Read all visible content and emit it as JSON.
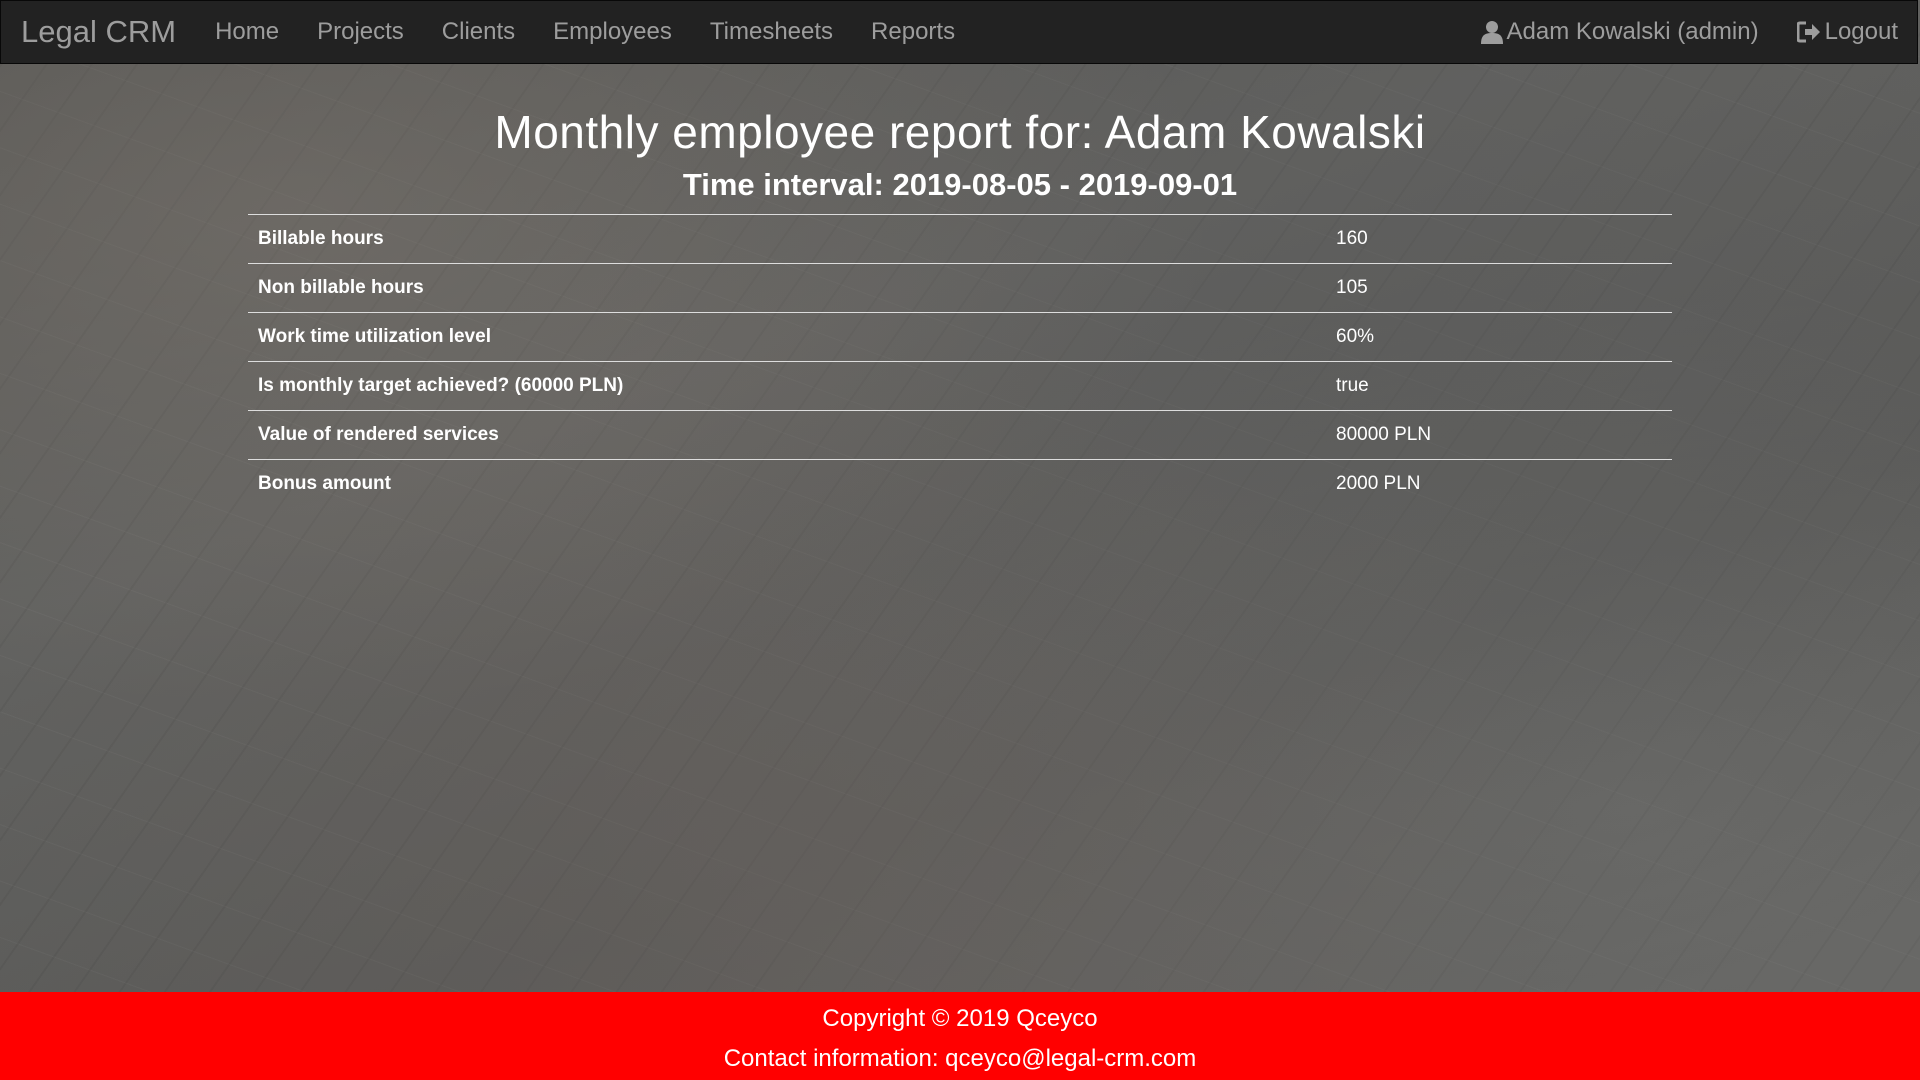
{
  "navbar": {
    "brand": "Legal CRM",
    "links": [
      "Home",
      "Projects",
      "Clients",
      "Employees",
      "Timesheets",
      "Reports"
    ],
    "user": "Adam Kowalski (admin)",
    "logout": "Logout",
    "user_icon": "user-icon",
    "logout_icon": "logout-icon"
  },
  "report": {
    "title": "Monthly employee report for: Adam Kowalski",
    "subtitle": "Time interval: 2019-08-05 - 2019-09-01",
    "rows": [
      {
        "label": "Billable hours",
        "value": "160"
      },
      {
        "label": "Non billable hours",
        "value": "105"
      },
      {
        "label": "Work time utilization level",
        "value": "60%"
      },
      {
        "label": "Is monthly target achieved? (60000 PLN)",
        "value": "true"
      },
      {
        "label": "Value of rendered services",
        "value": "80000 PLN"
      },
      {
        "label": "Bonus amount",
        "value": "2000 PLN"
      }
    ]
  },
  "footer": {
    "copyright": "Copyright © 2019 Qceyco",
    "contact": "Contact information: qceyco@legal-crm.com"
  },
  "colors": {
    "navbar": "#222222",
    "nav_text": "#9d9d9d",
    "footer": "#ff0000"
  }
}
